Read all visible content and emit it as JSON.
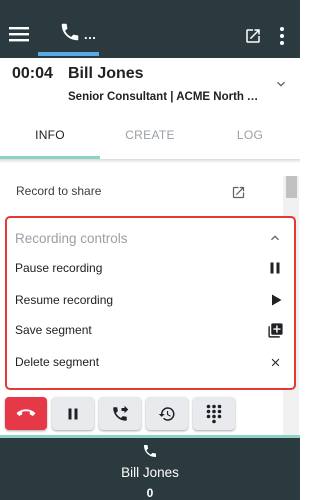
{
  "topbar": {
    "menu_icon": "menu-icon",
    "phone_tab_icon": "phone-icon",
    "phone_tab_more": "...",
    "popout_icon": "open-in-new-icon",
    "more_icon": "more-vert-icon"
  },
  "call": {
    "timer": "00:04",
    "caller_name": "Bill Jones",
    "caller_subtitle": "Senior Consultant | ACME North America",
    "expand_icon": "chevron-down-icon"
  },
  "tabs": [
    {
      "label": "INFO",
      "active": true
    },
    {
      "label": "CREATE",
      "active": false
    },
    {
      "label": "LOG",
      "active": false
    }
  ],
  "record_share": {
    "label": "Record to share",
    "icon": "open-in-new-icon"
  },
  "recording_controls": {
    "title": "Recording controls",
    "collapse_icon": "chevron-up-icon",
    "items": [
      {
        "label": "Pause recording",
        "icon": "pause-icon"
      },
      {
        "label": "Resume recording",
        "icon": "play-icon"
      },
      {
        "label": "Save segment",
        "icon": "library-add-icon"
      },
      {
        "label": "Delete segment",
        "icon": "close-icon"
      }
    ]
  },
  "action_buttons": [
    {
      "name": "hangup",
      "icon": "call-end-icon"
    },
    {
      "name": "hold",
      "icon": "pause-icon"
    },
    {
      "name": "transfer",
      "icon": "phone-forwarded-icon"
    },
    {
      "name": "history",
      "icon": "history-icon"
    },
    {
      "name": "dialpad",
      "icon": "dialpad-icon"
    }
  ],
  "bottom": {
    "phone_icon": "phone-icon",
    "name": "Bill Jones",
    "count": "0"
  },
  "colors": {
    "header_bg": "#2b3a3e",
    "accent_teal": "#8fd1c2",
    "accent_blue": "#5aa9e6",
    "danger_red": "#e53935",
    "hangup_red": "#e53947"
  }
}
